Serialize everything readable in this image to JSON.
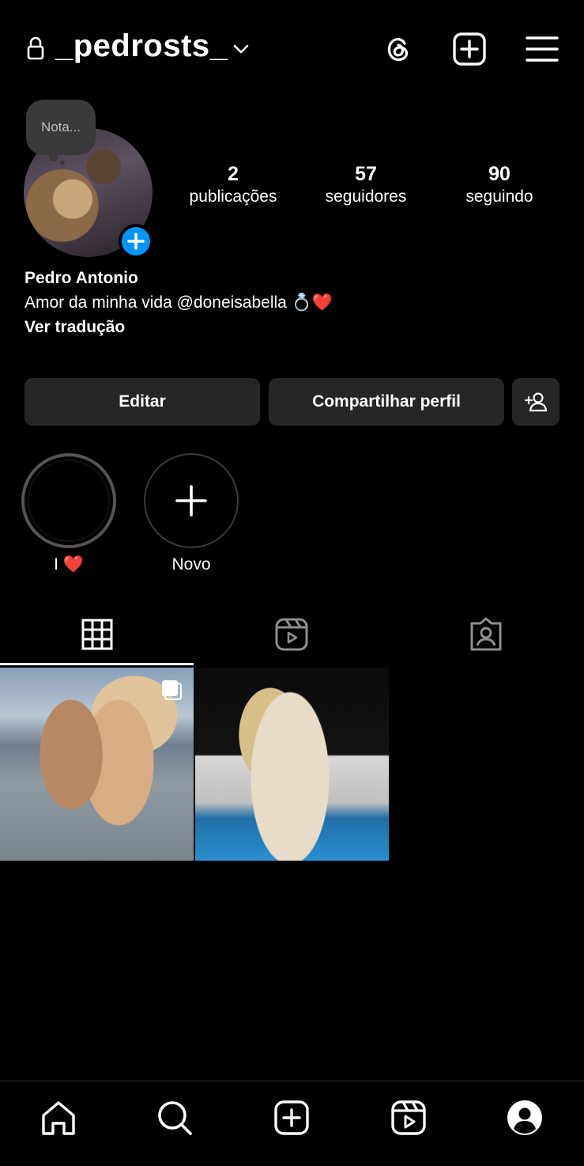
{
  "header": {
    "username": "_pedrosts_",
    "icons": [
      "lock-icon",
      "chevron-down-icon",
      "threads-icon",
      "add-post-icon",
      "menu-icon"
    ]
  },
  "profile": {
    "note_placeholder": "Nota...",
    "stats": [
      {
        "value": "2",
        "label": "publicações"
      },
      {
        "value": "57",
        "label": "seguidores"
      },
      {
        "value": "90",
        "label": "seguindo"
      }
    ],
    "name": "Pedro Antonio",
    "bio": "Amor da minha vida @doneisabella 💍❤️",
    "translate": "Ver tradução"
  },
  "actions": {
    "edit": "Editar",
    "share": "Compartilhar perfil"
  },
  "highlights": [
    {
      "label": "I ❤️"
    },
    {
      "label": "Novo"
    }
  ],
  "tabs": [
    "grid-icon",
    "reels-icon",
    "tagged-icon"
  ],
  "nav": [
    "home-icon",
    "search-icon",
    "create-icon",
    "reels-icon",
    "profile-icon"
  ],
  "colors": {
    "accent": "#0095f6",
    "button": "#262626",
    "background": "#000000"
  }
}
